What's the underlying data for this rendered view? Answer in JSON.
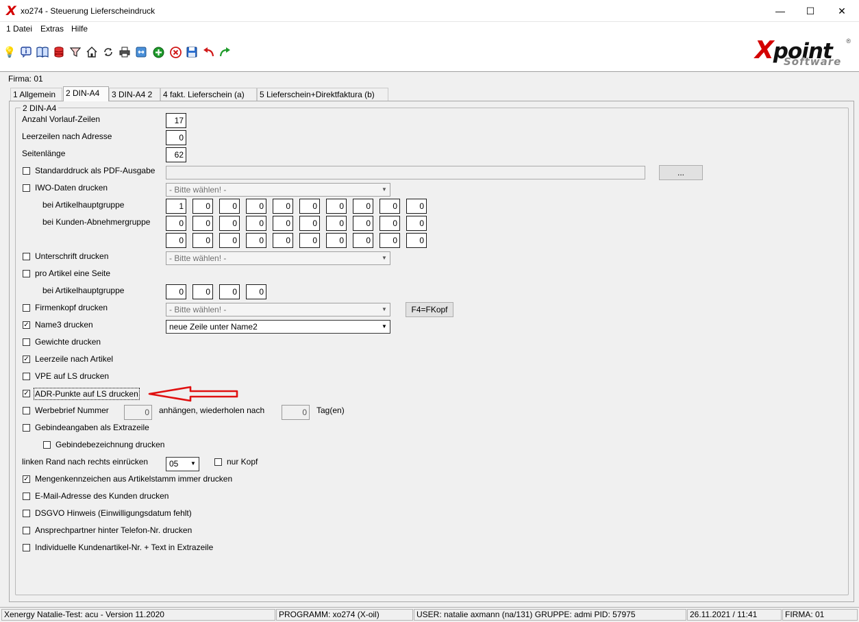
{
  "window": {
    "logo": "X",
    "title": "xo274 - Steuerung Lieferscheindruck",
    "minimize": "—",
    "maximize": "☐",
    "close": "✕"
  },
  "menu": [
    "1 Datei",
    "Extras",
    "Hilfe"
  ],
  "toolbar": {
    "icons": [
      "lightbulb-icon",
      "info-icon",
      "book-icon",
      "database-icon",
      "filter-icon",
      "home-icon",
      "refresh-icon",
      "printer-icon",
      "link-icon",
      "add-icon",
      "delete-icon",
      "save-icon",
      "undo-icon",
      "redo-icon"
    ],
    "logo": {
      "x": "X",
      "rest": "point",
      "sub": "Software",
      "reg": "®"
    }
  },
  "firma": "Firma:  01",
  "tabs": [
    "1 Allgemein",
    "2 DIN-A4",
    "3 DIN-A4 2",
    "4 fakt. Lieferschein (a)",
    "5 Lieferschein+Direktfaktura (b)"
  ],
  "active_tab": "2 DIN-A4",
  "group_title": "2 DIN-A4",
  "form": {
    "vorlauf_label": "Anzahl Vorlauf-Zeilen",
    "vorlauf_value": "17",
    "leerzeilen_label": "Leerzeilen nach Adresse",
    "leerzeilen_value": "0",
    "seitenlaenge_label": "Seitenlänge",
    "seitenlaenge_value": "62",
    "pdf_label": "Standarddruck als PDF-Ausgabe",
    "pdf_browse": "...",
    "iwo_label": "IWO-Daten drucken",
    "iwo_select": "- Bitte wählen! -",
    "artikelhauptgruppe_label": "bei Artikelhauptgruppe",
    "artikelhauptgruppe_values": [
      "1",
      "0",
      "0",
      "0",
      "0",
      "0",
      "0",
      "0",
      "0",
      "0"
    ],
    "kundengruppe_label": "bei Kunden-Abnehmergruppe",
    "kundengruppe_values": [
      "0",
      "0",
      "0",
      "0",
      "0",
      "0",
      "0",
      "0",
      "0",
      "0"
    ],
    "kundengruppe2_values": [
      "0",
      "0",
      "0",
      "0",
      "0",
      "0",
      "0",
      "0",
      "0",
      "0"
    ],
    "unterschrift_label": "Unterschrift drucken",
    "unterschrift_select": "- Bitte wählen! -",
    "proartikel_label": "pro Artikel eine Seite",
    "proartikel_gruppe_label": "bei Artikelhauptgruppe",
    "proartikel_values": [
      "0",
      "0",
      "0",
      "0"
    ],
    "firmenkopf_label": "Firmenkopf drucken",
    "firmenkopf_select": "- Bitte wählen! -",
    "fkopf_button": "F4=FKopf",
    "name3_label": "Name3 drucken",
    "name3_select": "neue Zeile unter Name2",
    "gewichte_label": "Gewichte drucken",
    "leerzeile_artikel_label": "Leerzeile nach Artikel",
    "vpe_label": "VPE auf LS drucken",
    "adr_label": "ADR-Punkte auf LS drucken",
    "werbebrief_label": "Werbebrief Nummer",
    "werbebrief_value": "0",
    "anhaengen_label": "anhängen, wiederholen nach",
    "tage_value": "0",
    "tage_label": "Tag(en)",
    "gebinde_label": "Gebindeangaben als Extrazeile",
    "gebindebez_label": "Gebindebezeichnung drucken",
    "rand_label": "linken Rand nach rechts einrücken",
    "rand_value": "05",
    "nurkopf_label": "nur Kopf",
    "mengen_label": "Mengenkennzeichen aus Artikelstamm immer drucken",
    "email_label": "E-Mail-Adresse des Kunden drucken",
    "dsgvo_label": "DSGVO Hinweis (Einwilligungsdatum fehlt)",
    "ansprech_label": "Ansprechpartner hinter Telefon-Nr. drucken",
    "individuell_label": "Individuelle Kundenartikel-Nr. + Text in Extrazeile"
  },
  "checks": {
    "pdf": false,
    "iwo": false,
    "unterschrift": false,
    "proartikel": false,
    "firmenkopf": false,
    "name3": true,
    "gewichte": false,
    "leerzeile_artikel": true,
    "vpe": false,
    "adr": true,
    "werbebrief": false,
    "gebinde": false,
    "gebindebez": false,
    "nurkopf": false,
    "mengen": true,
    "email": false,
    "dsgvo": false,
    "ansprech": false,
    "individuell": false
  },
  "check_mark": "✓",
  "dropdown_arrow": "▼",
  "accent_colors": {
    "arrow": "#e01010",
    "brand_red": "#d40000"
  },
  "status": {
    "left": "Xenergy Natalie-Test: acu - Version 11.2020",
    "program": "PROGRAMM: xo274 (X-oil)",
    "user": "USER: natalie axmann (na/131)  GRUPPE: admi  PID: 57975",
    "datetime": "26.11.2021 / 11:41",
    "firma": "FIRMA: 01"
  }
}
